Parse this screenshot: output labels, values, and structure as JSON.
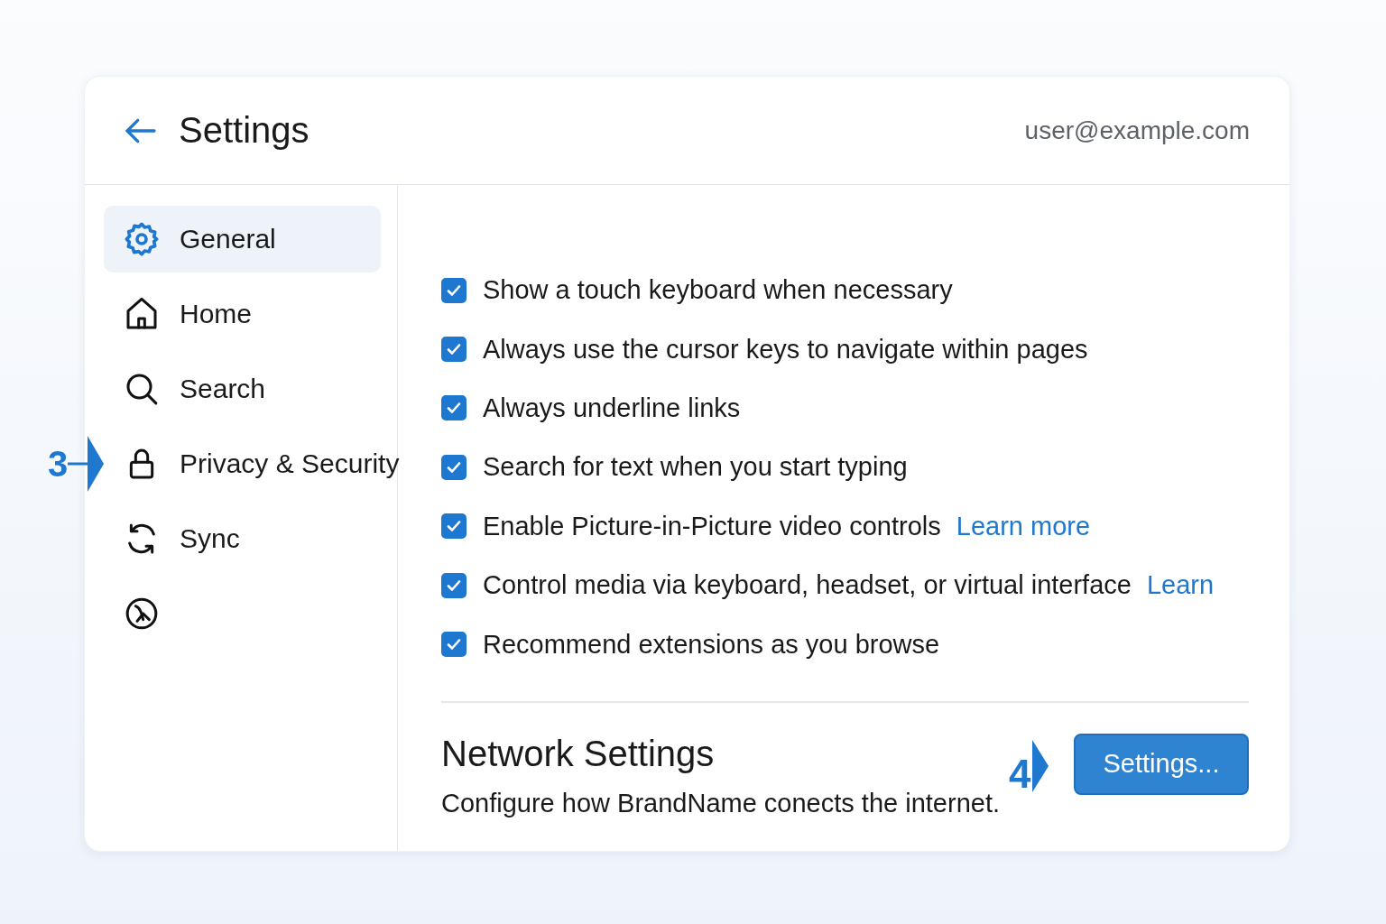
{
  "header": {
    "title": "Settings",
    "account": "user@example.com"
  },
  "sidebar": {
    "items": [
      {
        "kind": "gear",
        "label": "General",
        "selected": true
      },
      {
        "kind": "home",
        "label": "Home",
        "selected": false
      },
      {
        "kind": "search",
        "label": "Search",
        "selected": false
      },
      {
        "kind": "lock",
        "label": "Privacy & Security",
        "selected": false,
        "callout": "3"
      },
      {
        "kind": "sync",
        "label": "Sync",
        "selected": false
      },
      {
        "kind": "circle",
        "selected": false
      }
    ]
  },
  "options": [
    {
      "label": "Show a touch keyboard when necessary",
      "checked": true
    },
    {
      "label": "Always use the cursor keys to navigate within pages",
      "checked": true
    },
    {
      "label": "Always underline links",
      "checked": true
    },
    {
      "label": "Search for text when you start typing",
      "checked": true
    },
    {
      "label": "Enable Picture-in-Picture video controls",
      "checked": true,
      "link": "Learn more"
    },
    {
      "label": "Control media via keyboard, headset, or virtual interface",
      "checked": true,
      "link": "Learn"
    },
    {
      "label": "Recommend extensions as you browse",
      "checked": true
    }
  ],
  "network": {
    "title": "Network Settings",
    "description": "Configure how BrandName conects the internet.",
    "button": "Settings...",
    "callout": "4"
  }
}
